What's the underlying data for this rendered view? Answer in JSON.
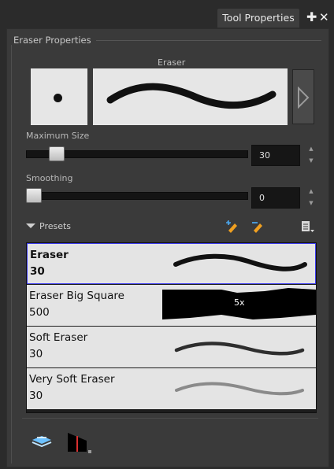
{
  "window": {
    "tab_label": "Tool Properties",
    "add_icon": "plus-icon",
    "close_icon": "close-icon"
  },
  "eraser_properties": {
    "group_label": "Eraser Properties",
    "tip_title": "Eraser",
    "next_icon": "arrow-right-icon",
    "maximum_size": {
      "label": "Maximum Size",
      "value": "30",
      "slider_fraction": 0.11
    },
    "smoothing": {
      "label": "Smoothing",
      "value": "0",
      "slider_fraction": 0.0
    },
    "presets": {
      "label": "Presets",
      "icons": [
        "new-preset-icon",
        "rename-preset-icon",
        "preset-menu-icon"
      ],
      "items": [
        {
          "name": "Eraser",
          "size": "30",
          "selected": true
        },
        {
          "name": "Eraser Big Square",
          "size": "500",
          "preview_label": "5x"
        },
        {
          "name": "Soft Eraser",
          "size": "30"
        },
        {
          "name": "Very Soft Eraser",
          "size": "30"
        }
      ]
    },
    "bottom_icons": [
      "brush-layers-icon",
      "stencil-icon"
    ]
  }
}
